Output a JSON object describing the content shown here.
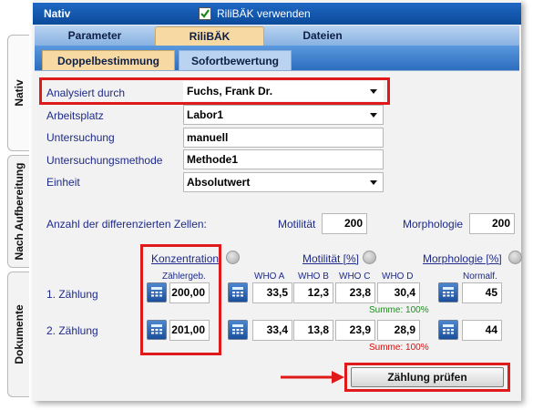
{
  "side_tabs": [
    "Nativ",
    "Nach Aufbereitung",
    "Dokumente"
  ],
  "title": {
    "text": "Nativ",
    "checkbox_label": "RiliBÄK verwenden",
    "checked": true
  },
  "tabs": [
    "Parameter",
    "RiliBÄK",
    "Dateien"
  ],
  "subtabs": [
    "Doppelbestimmung",
    "Sofortbewertung"
  ],
  "form": {
    "analysiert_label": "Analysiert durch",
    "analysiert_value": "Fuchs, Frank Dr.",
    "arbeitsplatz_label": "Arbeitsplatz",
    "arbeitsplatz_value": "Labor1",
    "untersuchung_label": "Untersuchung",
    "untersuchung_value": "manuell",
    "methode_label": "Untersuchungsmethode",
    "methode_value": "Methode1",
    "einheit_label": "Einheit",
    "einheit_value": "Absolutwert"
  },
  "cells": {
    "label": "Anzahl der differenzierten Zellen:",
    "motilitaet_label": "Motilität",
    "motilitaet_value": "200",
    "morphologie_label": "Morphologie",
    "morphologie_value": "200"
  },
  "headers": {
    "konzentration": "Konzentration",
    "motilitaet": "Motilität [%]",
    "morphologie": "Morphologie [%]",
    "zaehlergeb": "Zählergeb.",
    "who_a": "WHO A",
    "who_b": "WHO B",
    "who_c": "WHO C",
    "who_d": "WHO  D",
    "normalf": "Normalf."
  },
  "rows": [
    {
      "label": "1. Zählung",
      "konz": "200,00",
      "a": "33,5",
      "b": "12,3",
      "c": "23,8",
      "d": "30,4",
      "normal": "45",
      "summe": "Summe: 100%",
      "summe_status": "ok"
    },
    {
      "label": "2. Zählung",
      "konz": "201,00",
      "a": "33,4",
      "b": "13,8",
      "c": "23,9",
      "d": "28,9",
      "normal": "44",
      "summe": "Summe: 100%",
      "summe_status": "error"
    }
  ],
  "button": {
    "label": "Zählung prüfen"
  },
  "colors": {
    "highlight": "#e01a1a",
    "ok": "#1f8a1f",
    "error": "#d01010",
    "label": "#1e2a8a"
  }
}
